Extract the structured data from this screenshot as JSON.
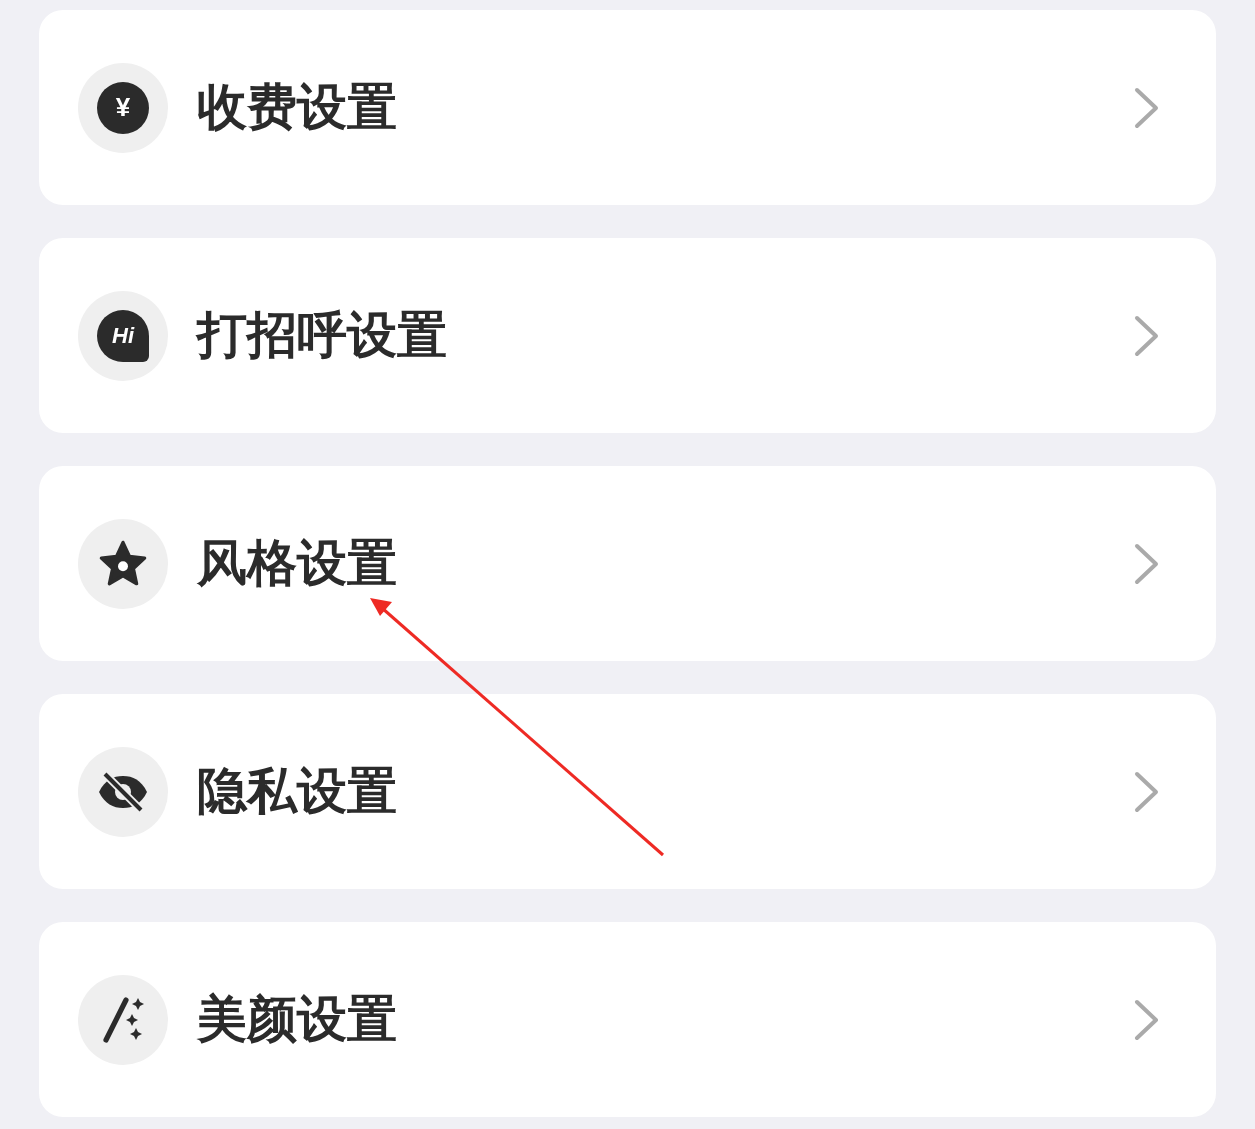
{
  "settings": [
    {
      "label": "收费设置",
      "kind": "yen",
      "icon_text": "¥"
    },
    {
      "label": "打招呼设置",
      "kind": "hi",
      "icon_text": "Hi"
    },
    {
      "label": "风格设置",
      "kind": "star"
    },
    {
      "label": "隐私设置",
      "kind": "eye-off"
    },
    {
      "label": "美颜设置",
      "kind": "wand"
    }
  ],
  "annotation": {
    "kind": "arrow",
    "color": "#ee2a24"
  }
}
